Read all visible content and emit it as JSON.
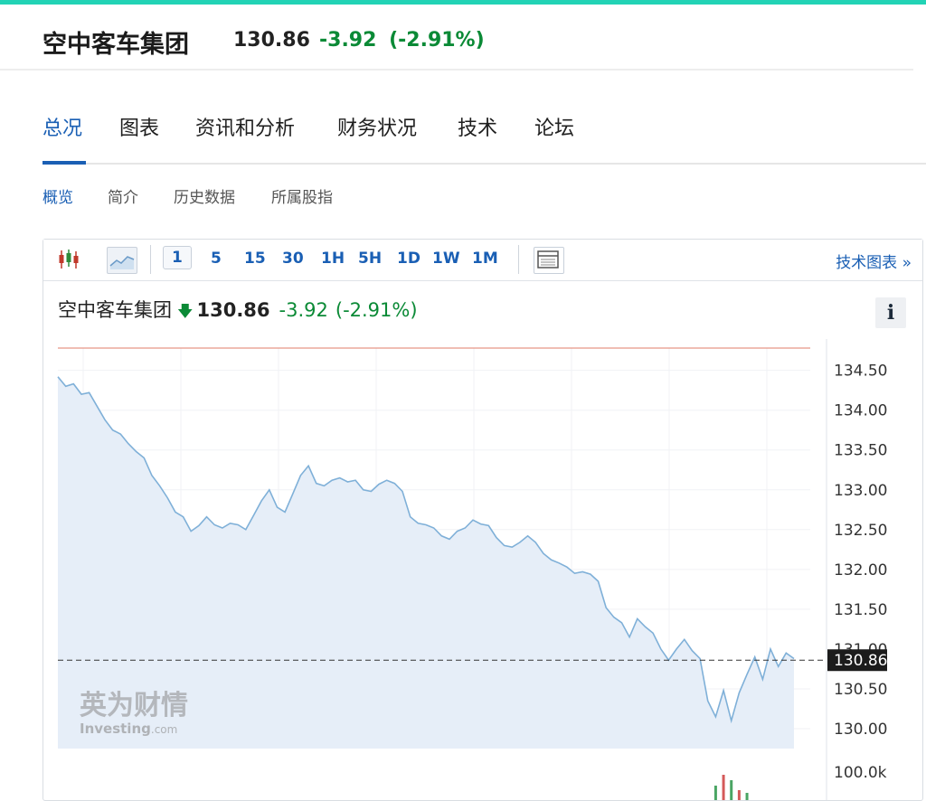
{
  "header": {
    "name": "空中客车集团",
    "price": "130.86",
    "change": "-3.92",
    "change_pct": "(-2.91%)"
  },
  "tabs": [
    "总况",
    "图表",
    "资讯和分析",
    "财务状况",
    "技术",
    "论坛"
  ],
  "subtabs": [
    "概览",
    "简介",
    "历史数据",
    "所属股指"
  ],
  "toolbar": {
    "intervals": [
      "1",
      "5",
      "15",
      "30",
      "1H",
      "5H",
      "1D",
      "1W",
      "1M"
    ],
    "selected_interval": "1",
    "tech_chart_link": "技术图表 »",
    "icons": [
      "candlestick-icon",
      "area-chart-icon",
      "table-view-icon",
      "info-icon"
    ]
  },
  "quote": {
    "name": "空中客车集团",
    "arrow": "🡇",
    "price": "130.86",
    "change": "-3.92",
    "change_pct": "(-2.91%)",
    "info": "i"
  },
  "watermark": {
    "cn": "英为财情",
    "en": "Investing",
    "en_suffix": ".com"
  },
  "colors": {
    "accent": "#1a5fb4",
    "down": "#0b8a36",
    "line": "#7fb0d8",
    "fill": "#e6eef8",
    "prev_close": "#e07d6a",
    "topbar": "#22d3b5"
  },
  "chart_data": {
    "type": "area",
    "ylim": [
      129.75,
      134.78
    ],
    "yticks": [
      134.5,
      134.0,
      133.5,
      133.0,
      132.5,
      132.0,
      131.5,
      130.5,
      130.0
    ],
    "ytick_labels": [
      "134.50",
      "134.00",
      "133.50",
      "133.00",
      "132.50",
      "132.00",
      "131.50",
      "130.50",
      "130.00"
    ],
    "partially_hidden_tick": "131.00",
    "last_price": 130.86,
    "last_price_label": "130.86",
    "prev_close": 134.78,
    "volume_label": "100.0k",
    "values": [
      134.42,
      134.3,
      134.33,
      134.2,
      134.22,
      134.05,
      133.88,
      133.75,
      133.7,
      133.58,
      133.48,
      133.4,
      133.18,
      133.05,
      132.9,
      132.72,
      132.66,
      132.48,
      132.55,
      132.66,
      132.56,
      132.52,
      132.58,
      132.56,
      132.5,
      132.68,
      132.86,
      133.0,
      132.78,
      132.72,
      132.95,
      133.18,
      133.3,
      133.08,
      133.05,
      133.12,
      133.15,
      133.1,
      133.12,
      133.0,
      132.98,
      133.07,
      133.12,
      133.08,
      132.98,
      132.66,
      132.58,
      132.56,
      132.52,
      132.42,
      132.38,
      132.48,
      132.52,
      132.62,
      132.57,
      132.55,
      132.4,
      132.3,
      132.28,
      132.34,
      132.42,
      132.34,
      132.2,
      132.12,
      132.08,
      132.03,
      131.95,
      131.97,
      131.94,
      131.85,
      131.52,
      131.4,
      131.33,
      131.15,
      131.38,
      131.28,
      131.2,
      131.0,
      130.86,
      131.0,
      131.12,
      130.98,
      130.88,
      130.35,
      130.15,
      130.48,
      130.1,
      130.45,
      130.68,
      130.9,
      130.62,
      131.0,
      130.78,
      130.95,
      130.88
    ],
    "volume_bars": [
      0,
      0,
      0,
      0,
      0,
      0,
      0,
      0,
      0,
      0,
      0,
      0,
      0,
      0,
      0,
      0,
      0,
      0,
      0,
      0,
      0,
      0,
      0,
      0,
      0,
      0,
      0,
      0,
      0,
      0,
      0,
      0,
      0,
      0,
      0,
      0,
      0,
      0,
      0,
      0,
      0,
      0,
      0,
      0,
      0,
      0,
      0,
      0,
      0,
      0,
      0,
      0,
      0,
      0,
      0,
      0,
      0,
      0,
      0,
      0,
      0,
      0,
      0,
      0,
      0,
      0,
      0,
      0,
      0,
      0,
      0,
      0,
      0,
      0,
      0,
      0,
      0,
      0,
      0,
      0,
      0,
      0,
      0,
      0,
      80,
      140,
      110,
      55,
      40,
      0,
      0,
      0,
      0,
      0,
      0
    ],
    "grid": true
  }
}
